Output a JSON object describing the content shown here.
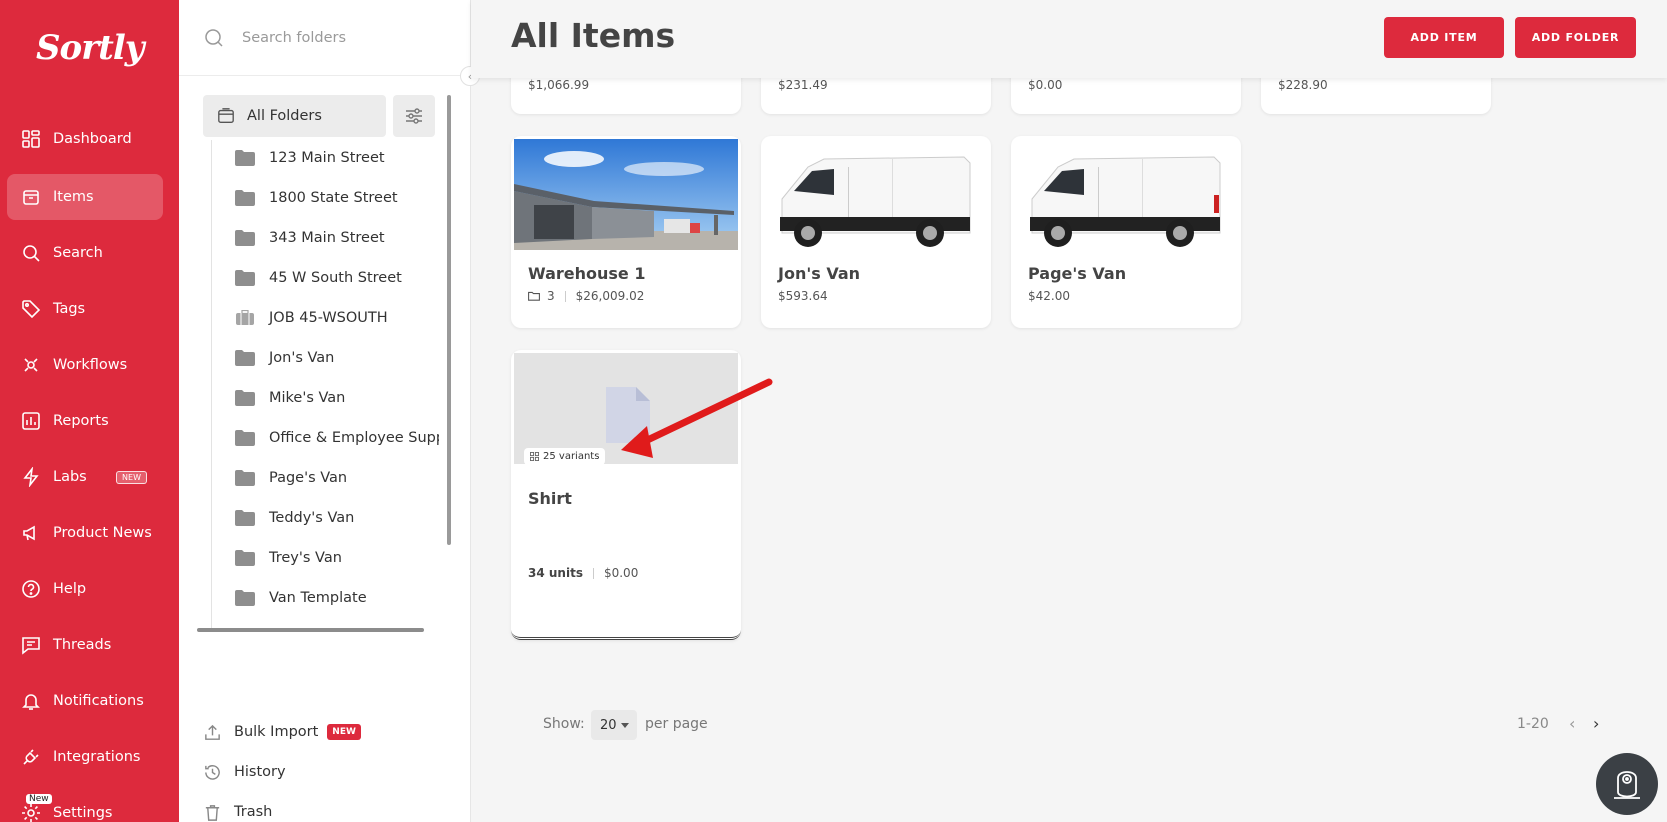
{
  "brand": {
    "logo_text": "Sortly",
    "accent": "#dd2a3d"
  },
  "nav": {
    "items": [
      {
        "label": "Dashboard",
        "icon": "dashboard-icon"
      },
      {
        "label": "Items",
        "icon": "items-icon",
        "active": true
      },
      {
        "label": "Search",
        "icon": "search-icon"
      },
      {
        "label": "Tags",
        "icon": "tag-icon"
      },
      {
        "label": "Workflows",
        "icon": "workflows-icon"
      },
      {
        "label": "Reports",
        "icon": "reports-icon"
      },
      {
        "label": "Labs",
        "icon": "labs-icon",
        "badge": "NEW"
      },
      {
        "label": "Product News",
        "icon": "megaphone-icon"
      },
      {
        "label": "Help",
        "icon": "help-icon"
      },
      {
        "label": "Threads",
        "icon": "threads-icon"
      },
      {
        "label": "Notifications",
        "icon": "bell-icon"
      },
      {
        "label": "Integrations",
        "icon": "plug-icon"
      },
      {
        "label": "Settings",
        "icon": "gear-icon",
        "badge": "New"
      }
    ]
  },
  "folders": {
    "search_placeholder": "Search folders",
    "all_folders_label": "All Folders",
    "items": [
      {
        "label": "123 Main Street",
        "icon": "folder-icon"
      },
      {
        "label": "1800 State Street",
        "icon": "folder-icon"
      },
      {
        "label": "343 Main Street",
        "icon": "folder-icon"
      },
      {
        "label": "45 W South Street",
        "icon": "folder-icon"
      },
      {
        "label": "JOB 45-WSOUTH",
        "icon": "briefcase-icon"
      },
      {
        "label": "Jon's Van",
        "icon": "folder-icon"
      },
      {
        "label": "Mike's Van",
        "icon": "folder-icon"
      },
      {
        "label": "Office & Employee Suppli",
        "icon": "folder-icon"
      },
      {
        "label": "Page's Van",
        "icon": "folder-icon"
      },
      {
        "label": "Teddy's Van",
        "icon": "folder-icon"
      },
      {
        "label": "Trey's Van",
        "icon": "folder-icon"
      },
      {
        "label": "Van Template",
        "icon": "folder-icon"
      }
    ],
    "bottom": {
      "bulk_import": "Bulk Import",
      "bulk_import_badge": "NEW",
      "history": "History",
      "trash": "Trash"
    }
  },
  "main": {
    "title": "All Items",
    "add_item": "ADD ITEM",
    "add_folder": "ADD FOLDER",
    "top_row_prices": [
      "$1,066.99",
      "$231.49",
      "$0.00",
      "$228.90"
    ],
    "cards": [
      {
        "name": "Warehouse 1",
        "folder_count": "3",
        "price": "$26,009.02"
      },
      {
        "name": "Jon's Van",
        "price": "$593.64"
      },
      {
        "name": "Page's Van",
        "price": "$42.00"
      },
      {
        "name": "Shirt",
        "variants": "25 variants",
        "units": "34 units",
        "price": "$0.00"
      }
    ],
    "pagination": {
      "show_label": "Show:",
      "per_page_value": "20",
      "per_page_label": "per page",
      "range": "1-20"
    }
  }
}
